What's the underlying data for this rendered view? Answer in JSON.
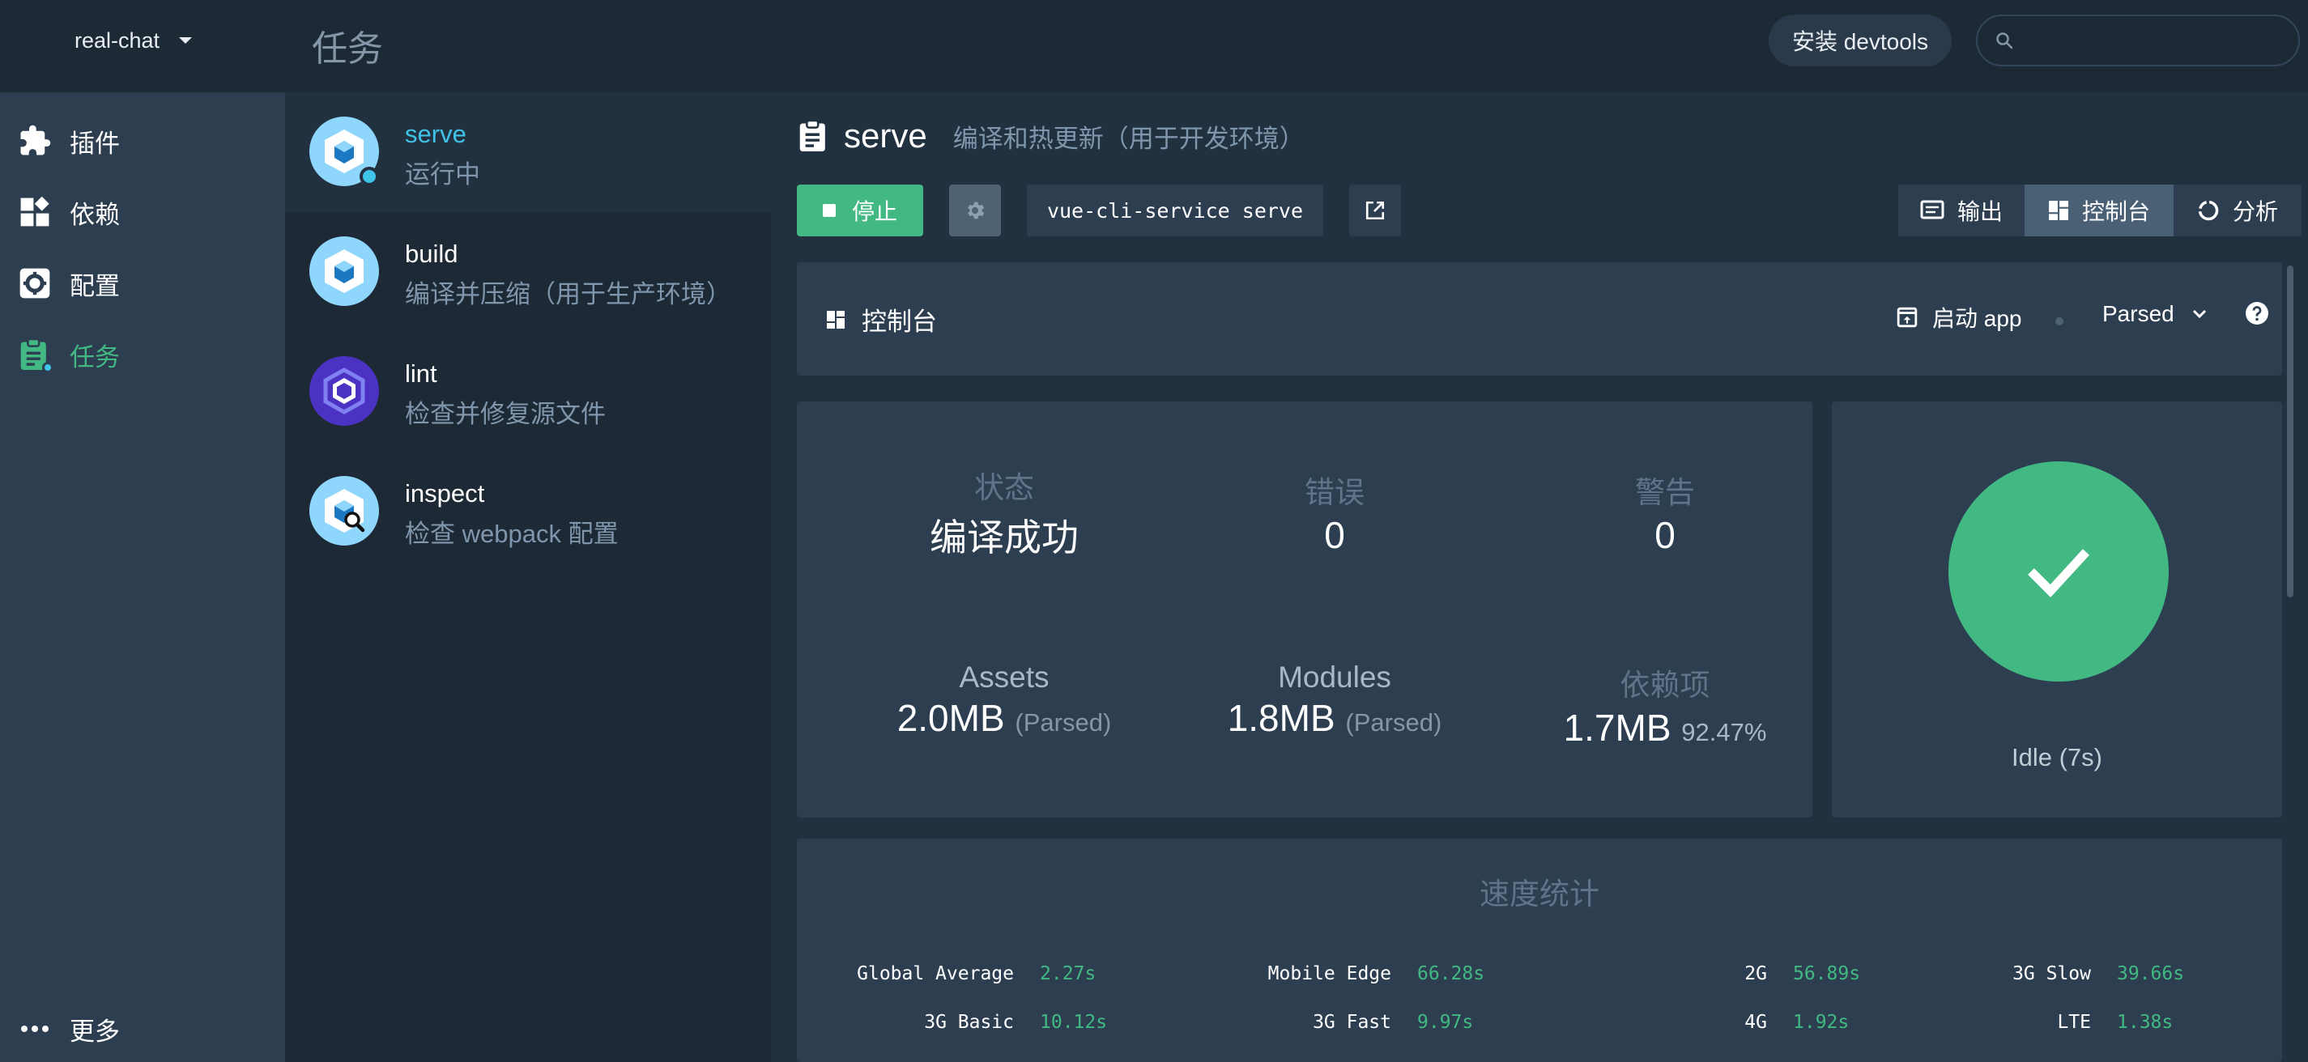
{
  "topbar": {
    "project_name": "real-chat",
    "page_title": "任务",
    "devtools_label": "安装 devtools",
    "search_placeholder": ""
  },
  "nav": {
    "items": [
      {
        "label": "插件",
        "icon": "puzzle-icon"
      },
      {
        "label": "依赖",
        "icon": "dependencies-icon"
      },
      {
        "label": "配置",
        "icon": "config-gear-icon"
      },
      {
        "label": "任务",
        "icon": "clipboard-icon",
        "active": true
      }
    ],
    "more_label": "更多"
  },
  "tasks": [
    {
      "name": "serve",
      "desc": "运行中",
      "icon": "webpack-icon",
      "selected": true,
      "running": true
    },
    {
      "name": "build",
      "desc": "编译并压缩（用于生产环境）",
      "icon": "webpack-icon"
    },
    {
      "name": "lint",
      "desc": "检查并修复源文件",
      "icon": "eslint-icon"
    },
    {
      "name": "inspect",
      "desc": "检查 webpack 配置",
      "icon": "webpack-inspect-icon"
    }
  ],
  "main": {
    "task_name": "serve",
    "task_desc": "编译和热更新（用于开发环境）",
    "stop_label": "停止",
    "command": "vue-cli-service serve",
    "tabs": [
      {
        "label": "输出",
        "icon": "output-icon"
      },
      {
        "label": "控制台",
        "icon": "dashboard-icon",
        "active": true
      },
      {
        "label": "分析",
        "icon": "analyzer-icon"
      }
    ]
  },
  "dashboard": {
    "title": "控制台",
    "launch_label": "启动 app",
    "parsed_label": "Parsed"
  },
  "stats": {
    "status_label": "状态",
    "status_value": "编译成功",
    "errors_label": "错误",
    "errors_value": "0",
    "warnings_label": "警告",
    "warnings_value": "0",
    "assets_label": "Assets",
    "assets_value": "2.0MB",
    "assets_unit": "(Parsed)",
    "modules_label": "Modules",
    "modules_value": "1.8MB",
    "modules_unit": "(Parsed)",
    "deps_label": "依赖项",
    "deps_value": "1.7MB",
    "deps_percent": "92.47%"
  },
  "status": {
    "label": "Idle (7s)",
    "color": "#42b983"
  },
  "speed": {
    "title": "速度统计",
    "rows": [
      {
        "k": "Global Average",
        "v": "2.27s"
      },
      {
        "k": "Mobile Edge",
        "v": "66.28s"
      },
      {
        "k": "2G",
        "v": "56.89s"
      },
      {
        "k": "3G Slow",
        "v": "39.66s"
      },
      {
        "k": "3G Basic",
        "v": "10.12s"
      },
      {
        "k": "3G Fast",
        "v": "9.97s"
      },
      {
        "k": "4G",
        "v": "1.92s"
      },
      {
        "k": "LTE",
        "v": "1.38s"
      }
    ]
  },
  "colors": {
    "accent": "#42b983",
    "link": "#3fc3e8",
    "bg": "#1d2935",
    "panel": "#2c3e50"
  }
}
